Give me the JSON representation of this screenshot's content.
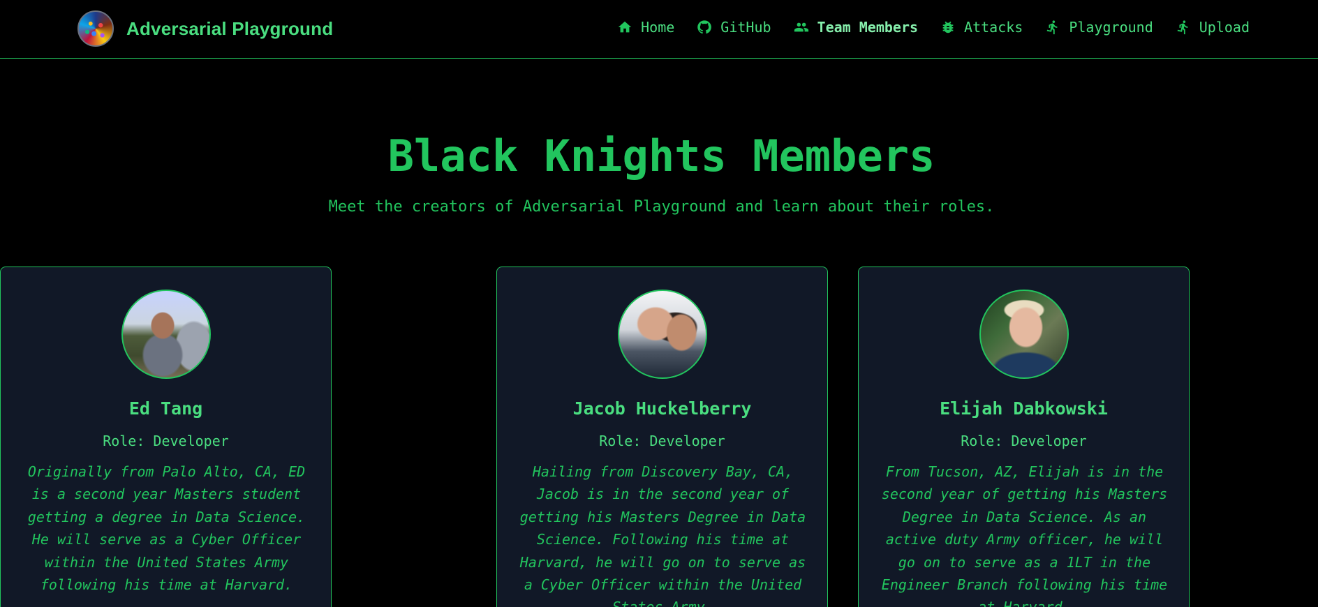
{
  "brand": {
    "title": "Adversarial Playground",
    "logo_icon": "playground-logo-icon"
  },
  "nav": {
    "items": [
      {
        "label": "Home",
        "icon": "home-icon"
      },
      {
        "label": "GitHub",
        "icon": "github-icon"
      },
      {
        "label": "Team Members",
        "icon": "users-icon",
        "active": true
      },
      {
        "label": "Attacks",
        "icon": "bug-icon"
      },
      {
        "label": "Playground",
        "icon": "running-person-icon"
      },
      {
        "label": "Upload",
        "icon": "running-person-icon"
      }
    ]
  },
  "header": {
    "title": "Black Knights Members",
    "subtitle": "Meet the creators of Adversarial Playground and learn about their roles."
  },
  "members": [
    {
      "name": "Jacob Huckelberry",
      "role": "Role: Developer",
      "bio": "Hailing from Discovery Bay, CA, Jacob is in the second year of getting his Masters Degree in Data Science. Following his time at Harvard, he will go on to serve as a Cyber Officer within the United States Army."
    },
    {
      "name": "Elijah Dabkowski",
      "role": "Role: Developer",
      "bio": "From Tucson, AZ, Elijah is in the second year of getting his Masters Degree in Data Science. As an active duty Army officer, he will go on to serve as a 1LT in the Engineer Branch following his time at Harvard."
    },
    {
      "name": "Ed Tang",
      "role": "Role: Developer",
      "bio": "Originally from Palo Alto, CA, ED is a second year Masters student getting a degree in Data Science. He will serve as a Cyber Officer within the United States Army following his time at Harvard."
    }
  ],
  "colors": {
    "background": "#000000",
    "accent": "#22c55e",
    "card_background": "#111827"
  }
}
